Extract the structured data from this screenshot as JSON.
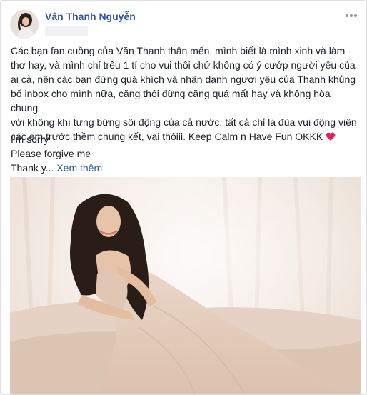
{
  "post": {
    "author": "Vân Thanh Nguyễn",
    "body_lines": [
      "Các bạn fan cuồng của Văn Thanh thân mến, mình biết là mình xinh và làm",
      "thơ hay, và mình chỉ trêu 1 tí cho vui thôi chứ không có ý cướp người yêu của",
      "ai cả, nên các bạn đừng quá khích và nhân danh người yêu của Thanh khủng",
      "bố inbox cho mình nữa, căng thôi đừng căng quá mất hay và không hòa chung",
      "với không khí tưng bừng sôi động của cả nước, tất cả chỉ là đùa vui động viên",
      "các em trước thềm chung kết, vại thôiii. Keep Calm n Have Fun OKKK"
    ],
    "extra_lines": [
      "I'm sorry",
      "Please forgive me"
    ],
    "truncated_line": "Thank y...",
    "see_more_label": "Xem thêm"
  },
  "icons": {
    "more": "more-options-icon",
    "heart": "heart-icon"
  },
  "colors": {
    "link": "#365899",
    "text": "#1d2129",
    "heart": "#e0245e"
  }
}
